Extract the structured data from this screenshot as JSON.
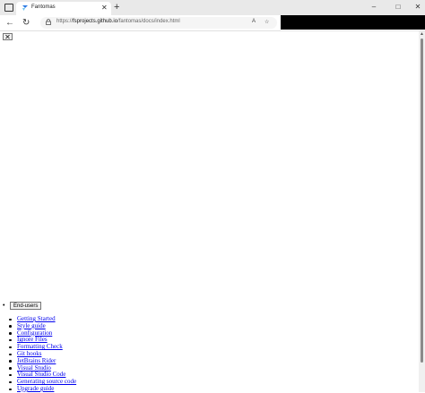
{
  "browser": {
    "tab_title": "Fantomas",
    "url_prefix": "https://",
    "url_host": "fsprojects.github.io",
    "url_path": "/fantomas/docs/index.html",
    "icons": {
      "new_tab": "+",
      "minimize": "–",
      "maximize": "□",
      "close": "✕",
      "back": "←",
      "refresh": "↻",
      "read_aloud": "A",
      "favorite": "☆"
    }
  },
  "page": {
    "close_label": "✕",
    "menu_button": "End-users",
    "links": [
      "Getting Started",
      "Style guide",
      "Configuration",
      "Ignore Files",
      "Formatting Check",
      "Git hooks",
      "JetBrains Rider",
      "Visual Studio",
      "Visual Studio Code",
      "Generating source code",
      "Upgrade guide"
    ]
  }
}
